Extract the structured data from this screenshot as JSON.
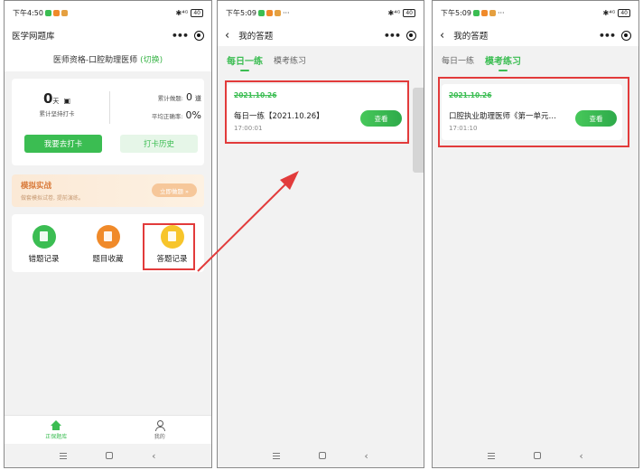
{
  "status_bar": {
    "p1_time": "下午4:50",
    "p2_time": "下午5:09",
    "p3_time": "下午5:09",
    "dots": "···",
    "signal": "✱⁴ᴳ",
    "battery": "40"
  },
  "screen1": {
    "title": "医学网题库",
    "qualification": "医师资格-口腔助理医师",
    "switch": "(切换)",
    "streak_value": "0",
    "streak_unit": "天",
    "streak_label": "累计坚持打卡",
    "total_label": "累计做题:",
    "total_value": "0",
    "total_unit": "道",
    "accuracy_label": "平均正确率:",
    "accuracy_value": "0%",
    "checkin_button": "我要去打卡",
    "history_button": "打卡历史",
    "mock_title": "模拟实战",
    "mock_subtitle": "做套模拟试卷, 提前演练。",
    "mock_button": "立即做题 »",
    "functions": [
      {
        "label": "错题记录",
        "icon": "wrong-record-icon"
      },
      {
        "label": "题目收藏",
        "icon": "favorites-icon"
      },
      {
        "label": "答题记录",
        "icon": "answer-record-icon"
      }
    ],
    "tabbar": [
      {
        "label": "正保题库",
        "icon": "home-icon"
      },
      {
        "label": "我的",
        "icon": "user-icon"
      }
    ]
  },
  "screen2": {
    "title": "我的答题",
    "tabs": [
      "每日一练",
      "模考练习"
    ],
    "active_tab": "每日一练",
    "record": {
      "date": "2021.10.26",
      "title": "每日一练【2021.10.26】",
      "time": "17:00:01",
      "button": "查看"
    }
  },
  "screen3": {
    "title": "我的答题",
    "tabs": [
      "每日一练",
      "模考练习"
    ],
    "active_tab": "模考练习",
    "record": {
      "date": "2021.10.26",
      "title": "口腔执业助理医师《第一单元…",
      "time": "17:01:10",
      "button": "查看"
    }
  },
  "colors": {
    "accent_green": "#3bbd52",
    "highlight_red": "#e23b3b",
    "mock_orange": "#d97a3a"
  }
}
